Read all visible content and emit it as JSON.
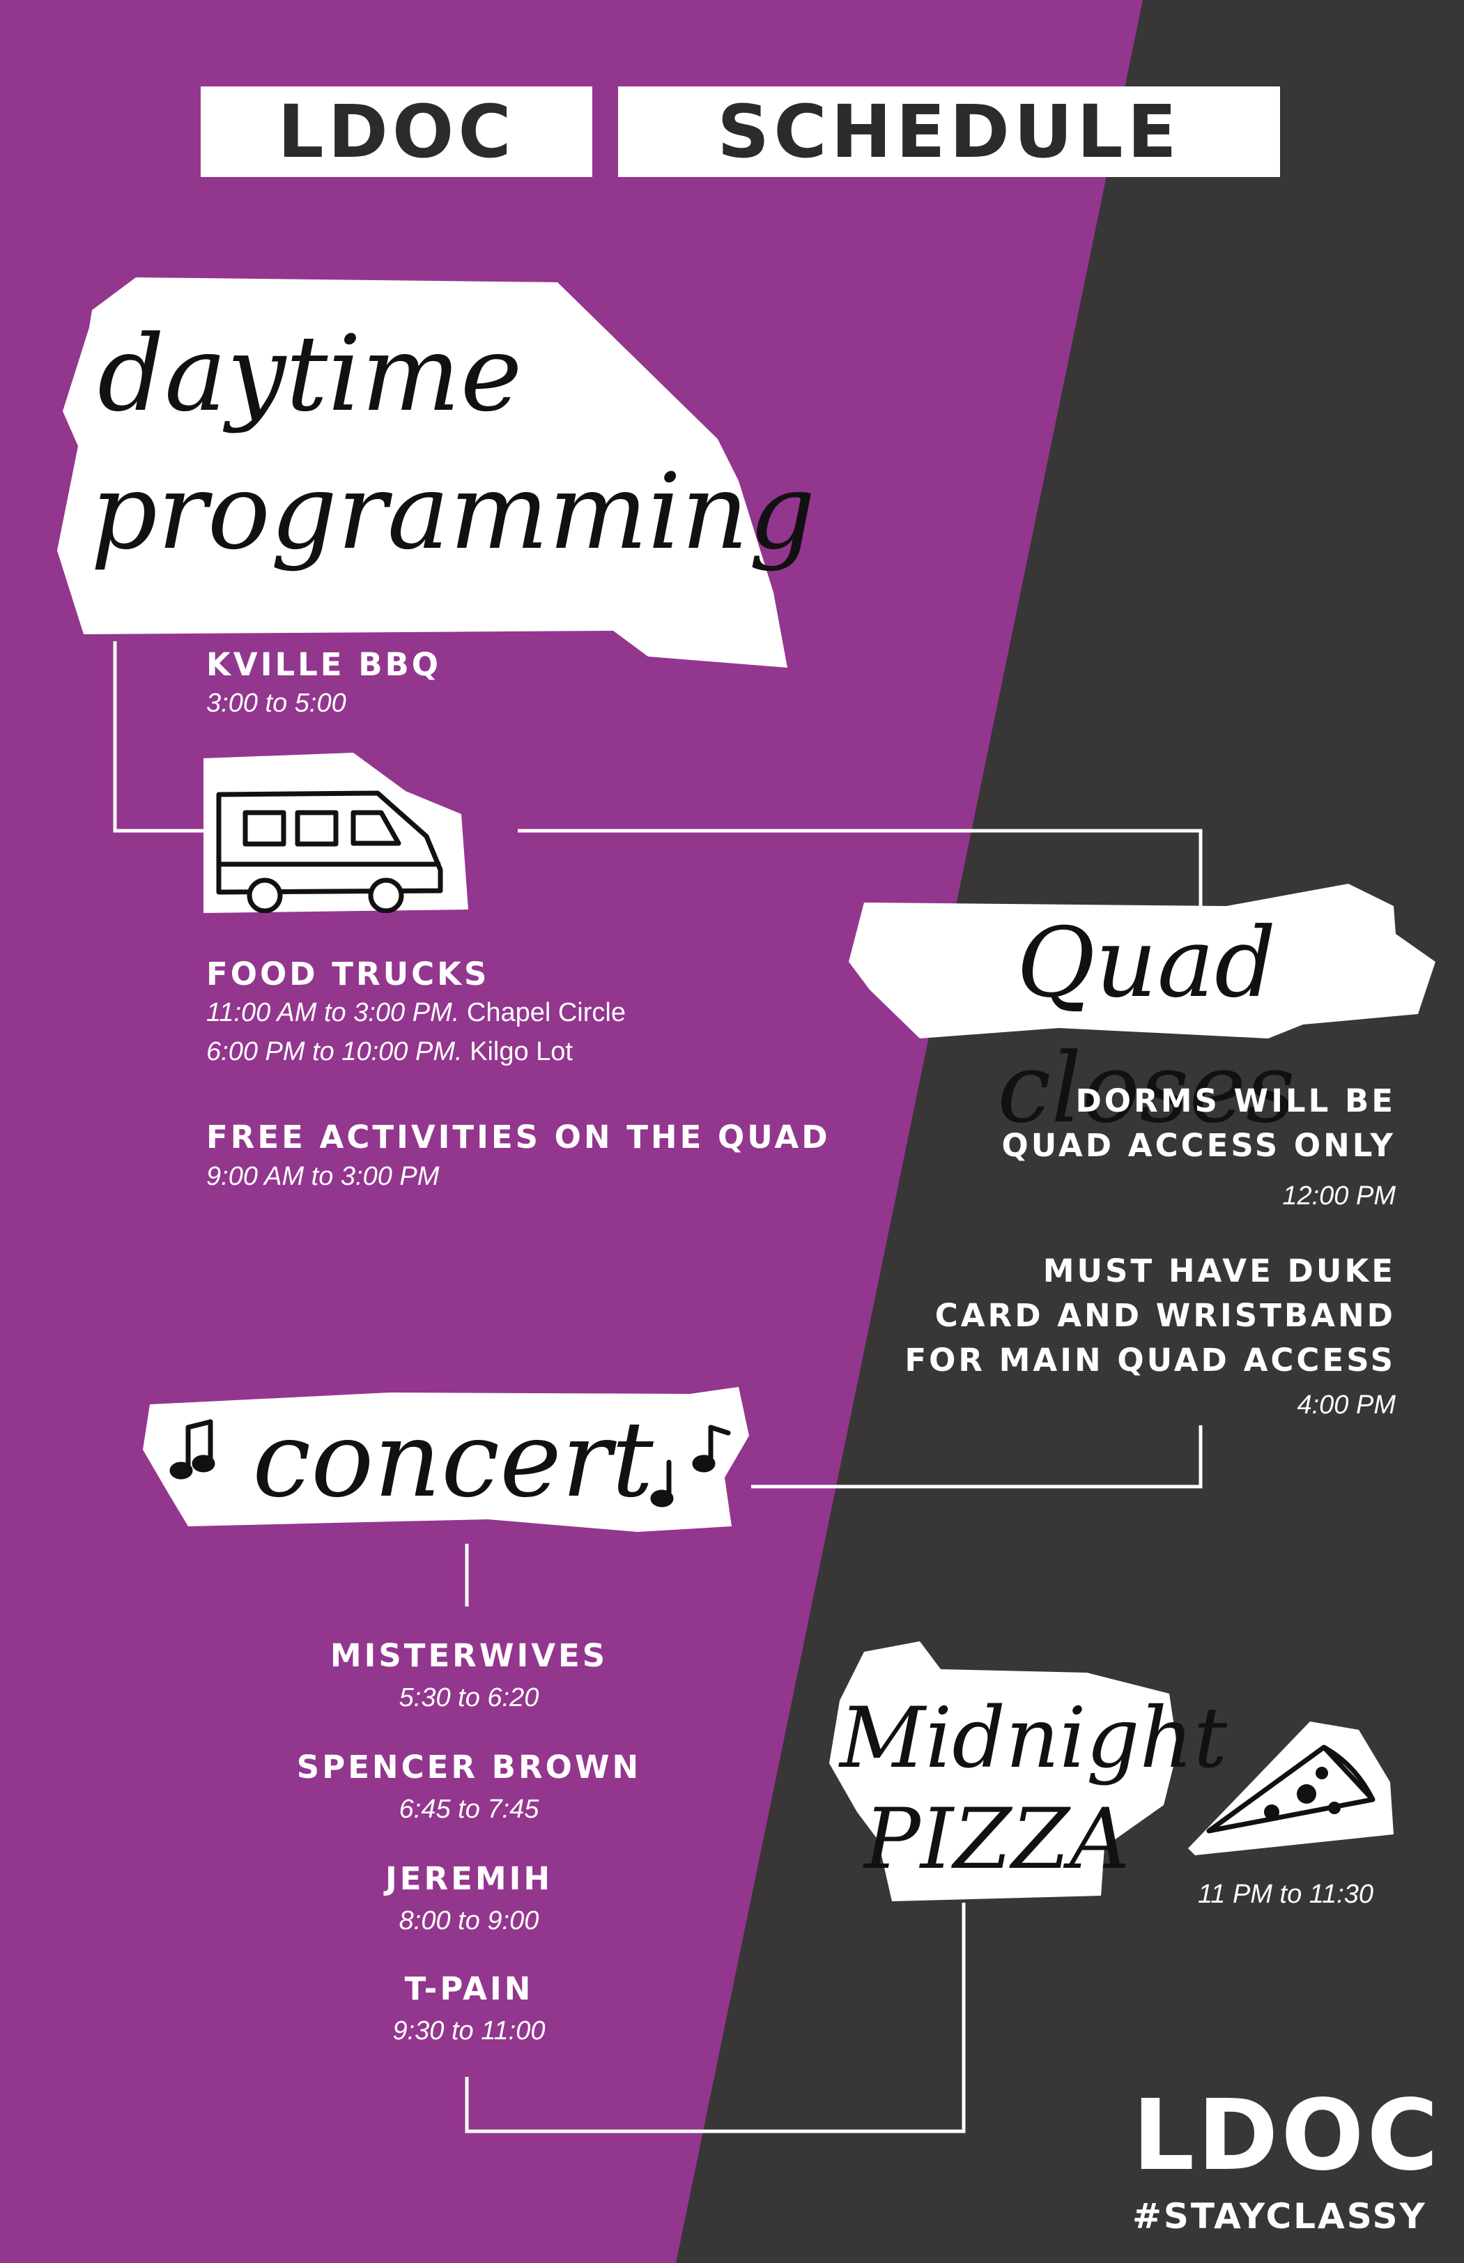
{
  "colors": {
    "purple": "#93368E",
    "dark": "#393637",
    "white": "#FFFFFF",
    "ink": "#1E1E1E"
  },
  "header": {
    "word1": "LDOC",
    "word2": "SCHEDULE"
  },
  "daytime": {
    "heading_line1": "daytime",
    "heading_line2": "programming",
    "items": [
      {
        "title": "KVILLE BBQ",
        "times": [
          "3:00 to 5:00"
        ]
      },
      {
        "title": "FOOD TRUCKS",
        "times": [
          "11:00 AM to 3:00 PM.",
          "6:00 PM to 10:00 PM."
        ],
        "locations": [
          "Chapel Circle",
          "Kilgo Lot"
        ]
      },
      {
        "title": "FREE ACTIVITIES ON THE QUAD",
        "times": [
          "9:00 AM to 3:00 PM"
        ]
      }
    ]
  },
  "quad": {
    "heading": "Quad closes",
    "items": [
      {
        "lines": [
          "DORMS WILL BE",
          "QUAD ACCESS ONLY"
        ],
        "time": "12:00 PM"
      },
      {
        "lines": [
          "MUST HAVE DUKE",
          "CARD AND WRISTBAND",
          "FOR MAIN QUAD ACCESS"
        ],
        "time": "4:00 PM"
      }
    ]
  },
  "concert": {
    "heading": "concert",
    "acts": [
      {
        "name": "MISTERWIVES",
        "time": "5:30 to 6:20"
      },
      {
        "name": "SPENCER BROWN",
        "time": "6:45 to 7:45"
      },
      {
        "name": "JEREMIH",
        "time": "8:00 to 9:00"
      },
      {
        "name": "T-PAIN",
        "time": "9:30 to 11:00"
      }
    ]
  },
  "pizza": {
    "heading_line1": "Midnight",
    "heading_line2": "PIZZA",
    "time": "11 PM to 11:30"
  },
  "logo": {
    "wordmark": "LDOC",
    "hashtag": "#STAYCLASSY"
  },
  "icons": [
    "food-truck-icon",
    "music-note-icon",
    "pizza-slice-icon"
  ]
}
